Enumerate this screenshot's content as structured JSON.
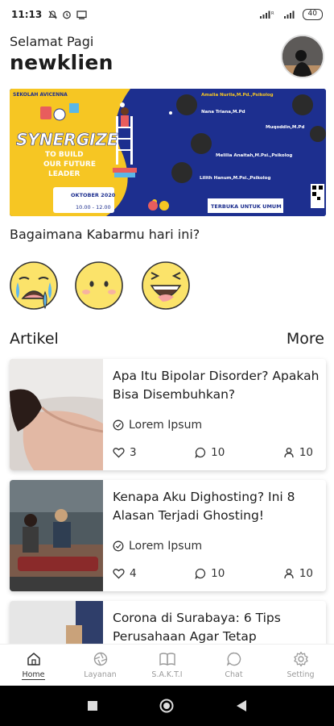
{
  "status": {
    "time": "11:13",
    "battery": "40"
  },
  "greeting": {
    "hello": "Selamat Pagi",
    "username": "newklien"
  },
  "banner": {
    "school": "SEKOLAH AVICENNA",
    "title": "SYNERGIZE",
    "subtitle_1": "TO BUILD",
    "subtitle_2": "OUR FUTURE",
    "subtitle_3": "LEADER",
    "date": "OKTOBER 2020",
    "time": "10.00 - 12.00",
    "open": "TERBUKA UNTUK UMUM",
    "speakers": [
      "Amalia Nurila,M.Pd.,Psikolog",
      "Nana Triana,M.Pd",
      "Muqoddin,M.Pd",
      "Melilia Anaitah,M.Psi.,Psikolog",
      "Lilith Hanum,M.Psi.,Psikolog"
    ]
  },
  "mood": {
    "question": "Bagaimana Kabarmu hari ini?",
    "options": [
      "sad",
      "neutral",
      "happy"
    ]
  },
  "articles": {
    "heading": "Artikel",
    "more": "More",
    "items": [
      {
        "title": "Apa Itu Bipolar Disorder? Apakah Bisa Disembuhkan?",
        "author": "Lorem Ipsum",
        "likes": "3",
        "comments": "10",
        "views": "10"
      },
      {
        "title": "Kenapa Aku Dighosting? Ini 8 Alasan Terjadi Ghosting!",
        "author": "Lorem Ipsum",
        "likes": "4",
        "comments": "10",
        "views": "10"
      },
      {
        "title": "Corona di Surabaya: 6 Tips Perusahaan Agar Tetap",
        "author": "",
        "likes": "",
        "comments": "",
        "views": ""
      }
    ]
  },
  "nav": [
    {
      "label": "Home",
      "icon": "home-icon"
    },
    {
      "label": "Layanan",
      "icon": "aperture-icon"
    },
    {
      "label": "S.A.K.T.I",
      "icon": "book-icon"
    },
    {
      "label": "Chat",
      "icon": "chat-icon"
    },
    {
      "label": "Setting",
      "icon": "gear-icon"
    }
  ],
  "colors": {
    "banner_bg": "#1d2f8f",
    "banner_accent": "#f6c623",
    "emoji_yellow": "#fbe36a"
  }
}
